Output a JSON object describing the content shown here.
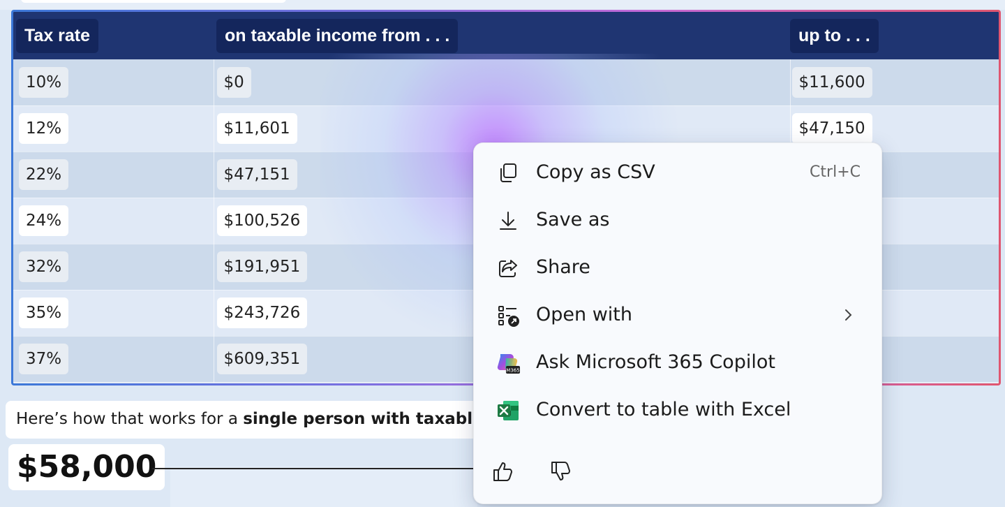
{
  "table": {
    "headers": [
      "Tax rate",
      "on taxable income from . . .",
      "up to . . ."
    ],
    "rows": [
      {
        "rate": "10%",
        "from": "$0",
        "to": "$11,600"
      },
      {
        "rate": "12%",
        "from": "$11,601",
        "to": "$47,150"
      },
      {
        "rate": "22%",
        "from": "$47,151",
        "to": ""
      },
      {
        "rate": "24%",
        "from": "$100,526",
        "to": ""
      },
      {
        "rate": "32%",
        "from": "$191,951",
        "to": ""
      },
      {
        "rate": "35%",
        "from": "$243,726",
        "to": ""
      },
      {
        "rate": "37%",
        "from": "$609,351",
        "to": ""
      }
    ]
  },
  "explain": {
    "prefix": "Here’s how that works for a ",
    "bold": "single person with taxable inc"
  },
  "amount": "$58,000",
  "context_menu": {
    "items": [
      {
        "label": "Copy as CSV",
        "shortcut": "Ctrl+C",
        "icon": "copy-icon"
      },
      {
        "label": "Save as",
        "icon": "download-icon"
      },
      {
        "label": "Share",
        "icon": "share-icon"
      },
      {
        "label": "Open with",
        "icon": "open-with-icon",
        "submenu": true
      },
      {
        "label": "Ask Microsoft 365 Copilot",
        "icon": "m365-copilot-icon"
      },
      {
        "label": "Convert to table with Excel",
        "icon": "excel-icon"
      }
    ],
    "feedback": [
      "thumbs-up-icon",
      "thumbs-down-icon"
    ]
  },
  "colors": {
    "header_bg": "#1f3572",
    "frame_gradient": [
      "#3c78d8",
      "#c56ad6",
      "#e0566f"
    ],
    "excel_green": "#1d7a43"
  }
}
